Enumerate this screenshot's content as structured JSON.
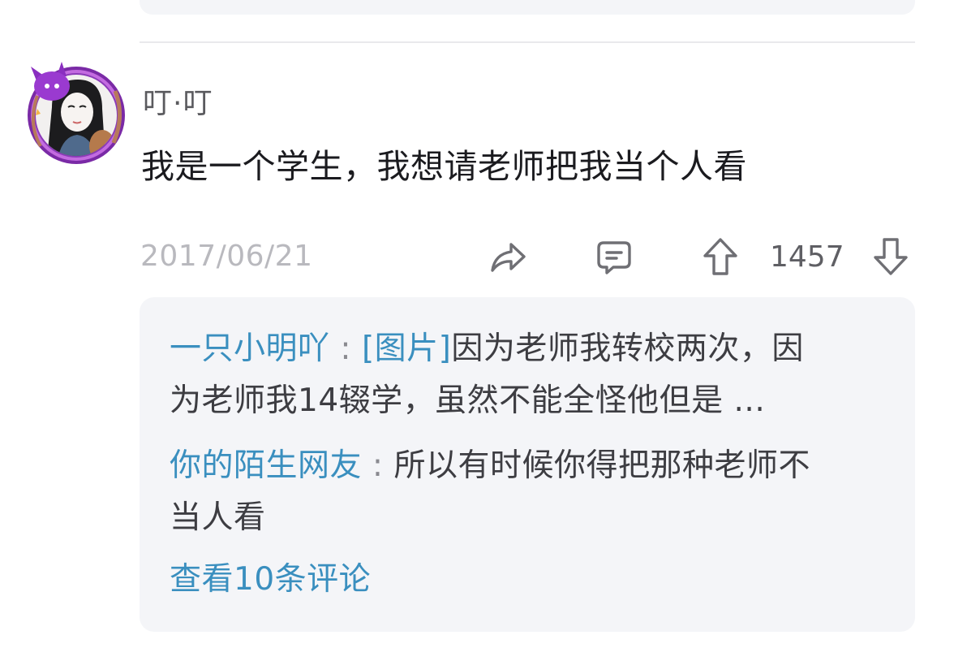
{
  "comment": {
    "username": "叮·叮",
    "text": "我是一个学生，我想请老师把我当个人看",
    "date": "2017/06/21",
    "vote_count": "1457"
  },
  "actions": {
    "share_icon": "share-icon",
    "comment_icon": "comment-icon",
    "upvote_icon": "upvote-arrow-icon",
    "downvote_icon": "downvote-arrow-icon"
  },
  "replies": [
    {
      "author": "一只小明吖",
      "separator": " : ",
      "tag": "[图片]",
      "text_line1": "因为老师我转校两次，因",
      "text_line2": "为老师我14辍学，虽然不能全怪他但是 ..."
    },
    {
      "author": "你的陌生网友",
      "separator": " : ",
      "text_line1": "所以有时候你得把那种老师不",
      "text_line2": "当人看"
    }
  ],
  "view_more_label": "查看10条评论",
  "colors": {
    "link_blue": "#3a8fbf",
    "reply_bg": "#f4f5f8",
    "avatar_frame": "#a23ac9"
  }
}
